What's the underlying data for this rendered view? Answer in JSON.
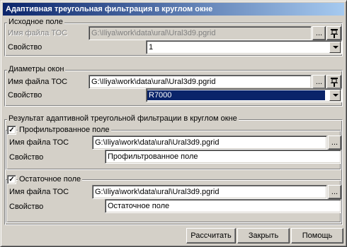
{
  "window": {
    "title": "Адаптивная треугольная фильтрация в круглом окне"
  },
  "source": {
    "legend": "Исходное поле",
    "file_label": "Имя файла ТОС",
    "file_value": "G:\\Iliya\\work\\data\\ural\\Ural3d9.pgrid",
    "browse_label": "...",
    "property_label": "Свойство",
    "property_value": "1"
  },
  "diameters": {
    "legend": "Диаметры окон",
    "file_label": "Имя файла ТОС",
    "file_value": "G:\\Iliya\\work\\data\\ural\\Ural3d9.pgrid",
    "browse_label": "...",
    "property_label": "Свойство",
    "property_value": "R7000"
  },
  "result": {
    "legend": "Результат адаптивной треугольной фильтрации в круглом окне",
    "filtered": {
      "check_mark": "✓",
      "checkbox_label": "Профильтрованное поле",
      "file_label": "Имя файла ТОС",
      "file_value": "G:\\Iliya\\work\\data\\ural\\Ural3d9.pgrid",
      "browse_label": "...",
      "property_label": "Свойство",
      "property_value": "Профильтрованное поле"
    },
    "residual": {
      "check_mark": "✓",
      "checkbox_label": "Остаточное поле",
      "file_label": "Имя файла ТОС",
      "file_value": "G:\\Iliya\\work\\data\\ural\\Ural3d9.pgrid",
      "browse_label": "...",
      "property_label": "Свойство",
      "property_value": "Остаточное поле"
    }
  },
  "buttons": {
    "calculate": "Рассчитать",
    "close": "Закрыть",
    "help": "Помощь"
  },
  "colors": {
    "face": "#d4d0c8",
    "title_start": "#0a246a",
    "title_end": "#a6caf0",
    "selection": "#0a246a"
  }
}
